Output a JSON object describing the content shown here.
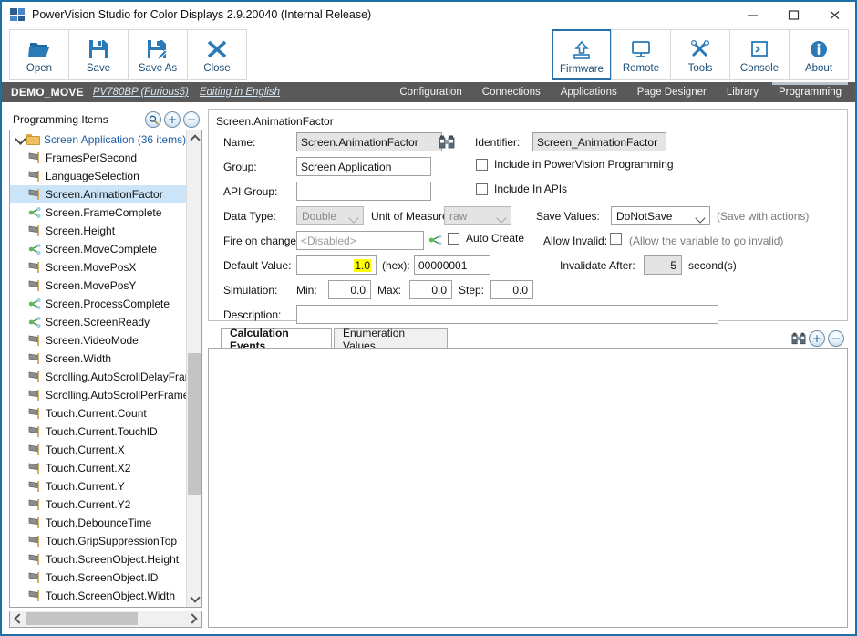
{
  "window": {
    "title": "PowerVision Studio for Color Displays 2.9.20040 (Internal Release)",
    "minimize_label": "—",
    "maximize_label": "□",
    "close_label": "✕"
  },
  "toolbar": {
    "left_buttons": [
      {
        "label": "Open",
        "icon": "open-folder-icon"
      },
      {
        "label": "Save",
        "icon": "floppy-disk-icon"
      },
      {
        "label": "Save As",
        "icon": "floppy-disk-pencil-icon"
      },
      {
        "label": "Close",
        "icon": "x-cross-icon"
      }
    ],
    "right_buttons": [
      {
        "label": "Firmware",
        "icon": "upload-chip-icon",
        "selected": true
      },
      {
        "label": "Remote",
        "icon": "monitor-icon",
        "selected": false
      },
      {
        "label": "Tools",
        "icon": "wrench-screwdriver-icon",
        "selected": false
      },
      {
        "label": "Console",
        "icon": "console-prompt-icon",
        "selected": false
      },
      {
        "label": "About",
        "icon": "info-circle-icon",
        "selected": false
      }
    ]
  },
  "navbar": {
    "project": "DEMO_MOVE",
    "device": "PV780BP (Furious5)",
    "language": "Editing in English",
    "tabs": [
      {
        "label": "Configuration",
        "active": false
      },
      {
        "label": "Connections",
        "active": false
      },
      {
        "label": "Applications",
        "active": false
      },
      {
        "label": "Page Designer",
        "active": false
      },
      {
        "label": "Library",
        "active": false
      },
      {
        "label": "Programming",
        "active": true
      }
    ]
  },
  "sidebar": {
    "title": "Programming Items",
    "tools": [
      {
        "name": "search-icon",
        "glyph": "🔍"
      },
      {
        "name": "add-icon",
        "glyph": "+"
      },
      {
        "name": "remove-icon",
        "glyph": "−"
      }
    ],
    "root": {
      "label": "Screen Application (36 items)",
      "icon": "folder-icon",
      "expanded": true
    },
    "items": [
      {
        "label": "FramesPerSecond",
        "icon": "flag-icon",
        "selected": false
      },
      {
        "label": "LanguageSelection",
        "icon": "flag-icon",
        "selected": false
      },
      {
        "label": "Screen.AnimationFactor",
        "icon": "flag-icon",
        "selected": true
      },
      {
        "label": "Screen.FrameComplete",
        "icon": "event-node-icon",
        "selected": false
      },
      {
        "label": "Screen.Height",
        "icon": "flag-icon",
        "selected": false
      },
      {
        "label": "Screen.MoveComplete",
        "icon": "event-node-icon",
        "selected": false
      },
      {
        "label": "Screen.MovePosX",
        "icon": "flag-icon",
        "selected": false
      },
      {
        "label": "Screen.MovePosY",
        "icon": "flag-icon",
        "selected": false
      },
      {
        "label": "Screen.ProcessComplete",
        "icon": "event-node-icon",
        "selected": false
      },
      {
        "label": "Screen.ScreenReady",
        "icon": "event-node-icon",
        "selected": false
      },
      {
        "label": "Screen.VideoMode",
        "icon": "flag-icon",
        "selected": false
      },
      {
        "label": "Screen.Width",
        "icon": "flag-icon",
        "selected": false
      },
      {
        "label": "Scrolling.AutoScrollDelayFram",
        "icon": "flag-icon",
        "selected": false
      },
      {
        "label": "Scrolling.AutoScrollPerFrame",
        "icon": "flag-icon",
        "selected": false
      },
      {
        "label": "Touch.Current.Count",
        "icon": "flag-icon",
        "selected": false
      },
      {
        "label": "Touch.Current.TouchID",
        "icon": "flag-icon",
        "selected": false
      },
      {
        "label": "Touch.Current.X",
        "icon": "flag-icon",
        "selected": false
      },
      {
        "label": "Touch.Current.X2",
        "icon": "flag-icon",
        "selected": false
      },
      {
        "label": "Touch.Current.Y",
        "icon": "flag-icon",
        "selected": false
      },
      {
        "label": "Touch.Current.Y2",
        "icon": "flag-icon",
        "selected": false
      },
      {
        "label": "Touch.DebounceTime",
        "icon": "flag-icon",
        "selected": false
      },
      {
        "label": "Touch.GripSuppressionTop",
        "icon": "flag-icon",
        "selected": false
      },
      {
        "label": "Touch.ScreenObject.Height",
        "icon": "flag-icon",
        "selected": false
      },
      {
        "label": "Touch.ScreenObject.ID",
        "icon": "flag-icon",
        "selected": false
      },
      {
        "label": "Touch.ScreenObject.Width",
        "icon": "flag-icon",
        "selected": false
      }
    ]
  },
  "form": {
    "header": "Screen.AnimationFactor",
    "name_label": "Name:",
    "name_value": "Screen.AnimationFactor",
    "name_browse_icon": "binoculars-icon",
    "identifier_label": "Identifier:",
    "identifier_value": "Screen_AnimationFactor",
    "group_label": "Group:",
    "group_value": "Screen Application",
    "api_group_label": "API Group:",
    "api_group_value": "",
    "include_pv_label": "Include in PowerVision Programming",
    "include_pv_checked": false,
    "include_api_label": "Include In APIs",
    "include_api_checked": false,
    "data_type_label": "Data Type:",
    "data_type_value": "Double",
    "unit_label": "Unit of Measure:",
    "unit_value": "raw",
    "save_values_label": "Save Values:",
    "save_values_value": "DoNotSave",
    "save_values_note": "(Save with actions)",
    "fire_on_change_label": "Fire on change:",
    "fire_on_change_value": "<Disabled>",
    "fire_event_icon": "event-node-icon",
    "auto_create_label": "Auto Create",
    "auto_create_checked": false,
    "allow_invalid_label": "Allow Invalid:",
    "allow_invalid_checked": false,
    "allow_invalid_note": "(Allow the variable to go invalid)",
    "invalidate_after_label": "Invalidate After:",
    "invalidate_after_value": "5",
    "invalidate_after_unit": "second(s)",
    "default_value_label": "Default Value:",
    "default_value": "1.0",
    "hex_label": "(hex):",
    "hex_value": "00000001",
    "simulation_label": "Simulation:",
    "min_label": "Min:",
    "min_value": "0.0",
    "max_label": "Max:",
    "max_value": "0.0",
    "step_label": "Step:",
    "step_value": "0.0",
    "description_label": "Description:",
    "description_value": ""
  },
  "bottom_tabs": {
    "tabs": [
      {
        "label": "Calculation Events",
        "active": true
      },
      {
        "label": "Enumeration Values",
        "active": false
      }
    ],
    "tools": [
      {
        "name": "binoculars-icon",
        "glyph": ""
      },
      {
        "name": "add-icon",
        "glyph": "+"
      },
      {
        "name": "remove-icon",
        "glyph": "−"
      }
    ]
  },
  "colors": {
    "window_border": "#1e6ea7",
    "navbar_bg": "#595959",
    "accent_blue": "#1d4f77",
    "selection_blue": "#cce4f7",
    "highlight_yellow": "#ffff00"
  }
}
